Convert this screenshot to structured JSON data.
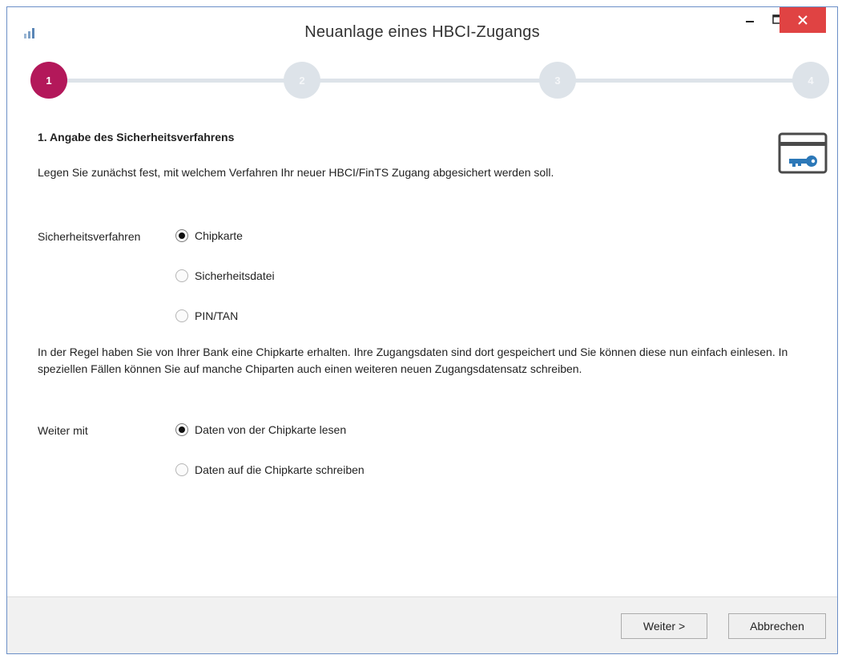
{
  "window": {
    "title": "Neuanlage eines HBCI-Zugangs",
    "controls": {
      "minimize": "–",
      "maximize": "☐",
      "close": "✕"
    }
  },
  "stepper": {
    "current": 1,
    "steps": [
      {
        "label": "1"
      },
      {
        "label": "2"
      },
      {
        "label": "3"
      },
      {
        "label": "4"
      }
    ],
    "active_color": "#b3185a",
    "inactive_color": "#dde3e9"
  },
  "section": {
    "heading": "1. Angabe des Sicherheitsverfahrens",
    "subtitle": "Legen Sie zunächst fest, mit welchem Verfahren Ihr neuer HBCI/FinTS Zugang abgesichert werden soll.",
    "icon": "card-key-icon"
  },
  "security": {
    "label": "Sicherheitsverfahren",
    "options": [
      {
        "label": "Chipkarte",
        "selected": true
      },
      {
        "label": "Sicherheitsdatei",
        "selected": false
      },
      {
        "label": "PIN/TAN",
        "selected": false
      }
    ]
  },
  "info_text": "In der Regel haben Sie von Ihrer Bank eine Chipkarte erhalten. Ihre Zugangsdaten sind dort gespeichert und Sie können diese nun einfach einlesen. In speziellen Fällen können Sie auf manche Chiparten auch einen weiteren neuen Zugangsdatensatz schreiben.",
  "next_with": {
    "label": "Weiter mit",
    "options": [
      {
        "label": "Daten von der Chipkarte lesen",
        "selected": true
      },
      {
        "label": "Daten auf die Chipkarte schreiben",
        "selected": false
      }
    ]
  },
  "footer": {
    "next_label": "Weiter >",
    "cancel_label": "Abbrechen"
  }
}
